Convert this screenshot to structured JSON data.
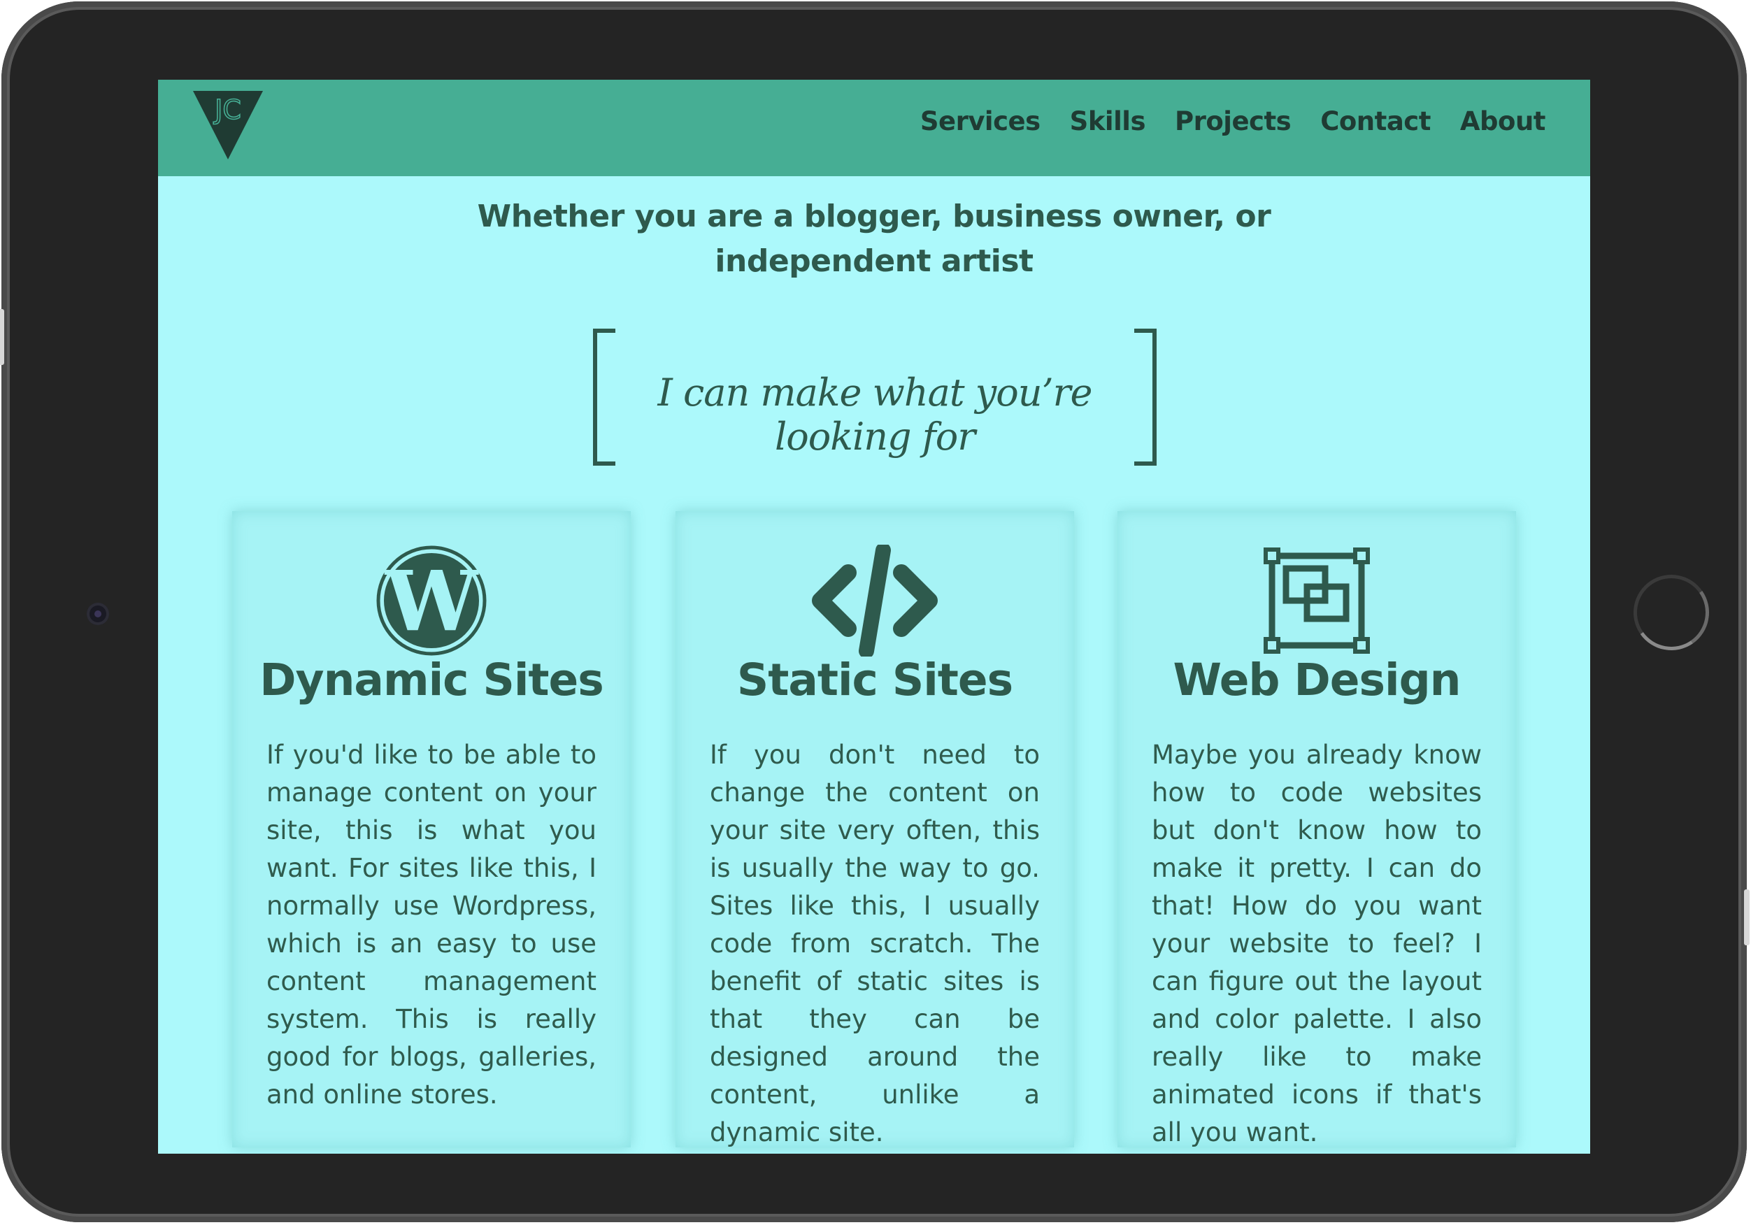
{
  "nav": {
    "logo_text": "JC",
    "items": [
      "Services",
      "Skills",
      "Projects",
      "Contact",
      "About"
    ]
  },
  "intro": "Whether you are a blogger, business owner, or independent artist",
  "tagline": "I can make what you’re looking for",
  "cards": [
    {
      "icon": "wordpress-icon",
      "title": "Dynamic Sites",
      "text": "If you'd like to be able to manage content on your site, this is what you want. For sites like this, I normally use Wordpress, which is an easy to use content management system. This is really good for blogs, galleries, and online stores."
    },
    {
      "icon": "code-icon",
      "title": "Static Sites",
      "text": "If you don't need to change the content on your site very often, this is usually the way to go. Sites like this, I usually code from scratch. The benefit of static sites is that they can be designed around the content, unlike a dynamic site."
    },
    {
      "icon": "design-frame-icon",
      "title": "Web Design",
      "text": "Maybe you already know how to code websites but don't know how to make it pretty. I can do that! How do you want your website to feel? I can figure out the layout and color palette. I also really like to make animated icons if that's all you want."
    }
  ],
  "colors": {
    "navbar": "#46ae94",
    "screen_bg": "#acf9fb",
    "text": "#2e5a4d",
    "frame": "#242424"
  }
}
